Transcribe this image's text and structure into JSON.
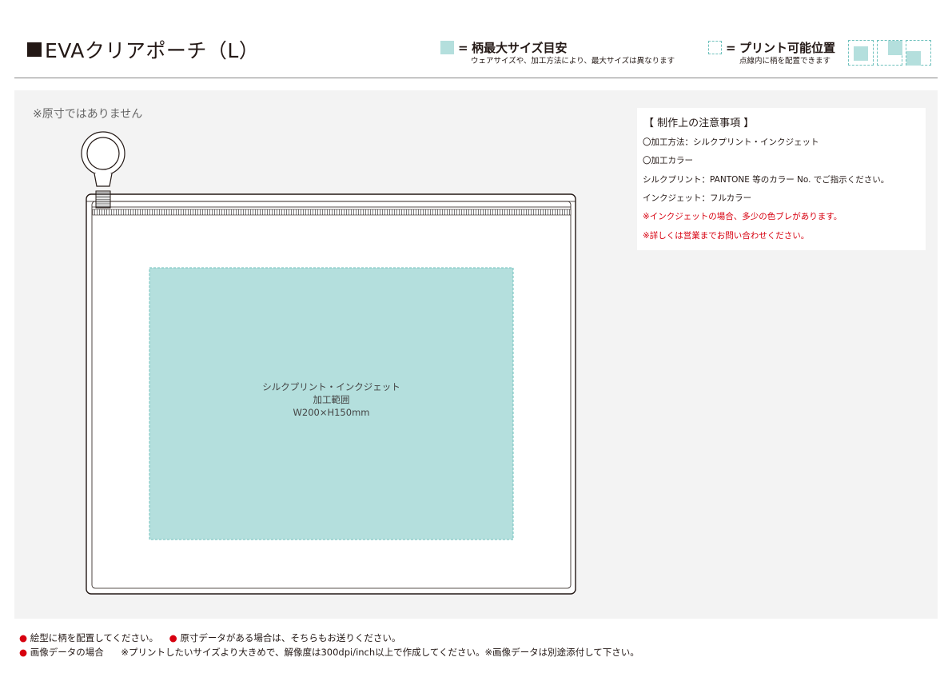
{
  "header": {
    "title": "EVAクリアポーチ（L）",
    "legend_area": {
      "equals": "=",
      "label": "柄最大サイズ目安",
      "note": "ウェアサイズや、加工方法により、最大サイズは異なります",
      "swatch_color": "#b4dfdd"
    },
    "legend_position": {
      "equals": "=",
      "label": "プリント可能位置",
      "note": "点線内に柄を配置できます",
      "dash_color": "#6fc1bd"
    }
  },
  "main": {
    "scale_note": "※原寸ではありません",
    "print_area": {
      "line1": "シルクプリント・インクジェット",
      "line2": "加工範囲",
      "line3": "W200×H150mm"
    }
  },
  "notes": {
    "title": "【 制作上の注意事項 】",
    "method": "〇加工方法：シルクプリント・インクジェット",
    "color_heading": "〇加工カラー",
    "silk": "シルクプリント：PANTONE 等のカラー No. でご指示ください。",
    "inkjet": "インクジェット：フルカラー",
    "warning1": "※インクジェットの場合、多少の色ブレがあります。",
    "warning2": "※詳しくは営業までお問い合わせください。"
  },
  "footer": {
    "line1_a": "絵型に柄を配置してください。",
    "line1_b": "原寸データがある場合は、そちらもお送りください。",
    "line2_a": "画像データの場合",
    "line2_b": "※プリントしたいサイズより大きめで、解像度は300dpi/inch以上で作成してください。※画像データは別途添付して下さい。",
    "bullet": "●"
  },
  "colors": {
    "accent_teal": "#b4dfdd",
    "dash_teal": "#6fc1bd",
    "warning_red": "#d7000f"
  }
}
